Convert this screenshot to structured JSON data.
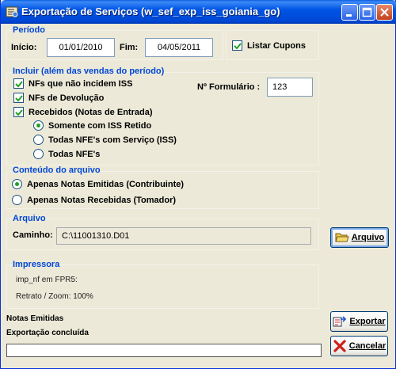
{
  "window": {
    "title": "Exportação de Serviços (w_sef_exp_iss_goiania_go)",
    "controls": [
      "minimize-icon",
      "maximize-icon",
      "close-icon"
    ]
  },
  "periodo": {
    "label": "Período",
    "inicio_label": "Início:",
    "inicio_value": "01/01/2010",
    "fim_label": "Fim:",
    "fim_value": "04/05/2011",
    "listar_cupons_label": "Listar Cupons",
    "listar_cupons_checked": true
  },
  "incluir": {
    "label": "Incluir (além das vendas do período)",
    "checks": [
      {
        "label": "NFs que não incidem ISS",
        "checked": true
      },
      {
        "label": "NFs de Devolução",
        "checked": true
      },
      {
        "label": "Recebidos (Notas de Entrada)",
        "checked": true
      }
    ],
    "radios": [
      {
        "label": "Somente com ISS Retido",
        "selected": true
      },
      {
        "label": "Todas NFE's com Serviço (ISS)",
        "selected": false
      },
      {
        "label": "Todas NFE's",
        "selected": false
      }
    ],
    "formulario_label": "Nº Formulário :",
    "formulario_value": "123"
  },
  "conteudo": {
    "label": "Conteúdo do arquivo",
    "options": [
      {
        "label": "Apenas Notas Emitidas (Contribuinte)",
        "selected": true
      },
      {
        "label": "Apenas Notas Recebidas (Tomador)",
        "selected": false
      }
    ]
  },
  "arquivo": {
    "label": "Arquivo",
    "caminho_label": "Caminho:",
    "caminho_value": "C:\\11001310.D01",
    "button_label": "Arquivo"
  },
  "impressora": {
    "label": "Impressora",
    "line1": "imp_nf em FPR5:",
    "line2": "Retrato / Zoom: 100%"
  },
  "status": {
    "line1": "Notas Emitidas",
    "line2": "Exportação concluída",
    "progress": 0
  },
  "buttons": {
    "exportar_label": "Exportar",
    "cancelar_label": "Cancelar"
  },
  "colors": {
    "group_label": "#0046d5",
    "window_bg": "#ece9d8",
    "titlebar": "#0055e5",
    "check_mark": "#21a121",
    "cancel_x": "#d0201a"
  }
}
